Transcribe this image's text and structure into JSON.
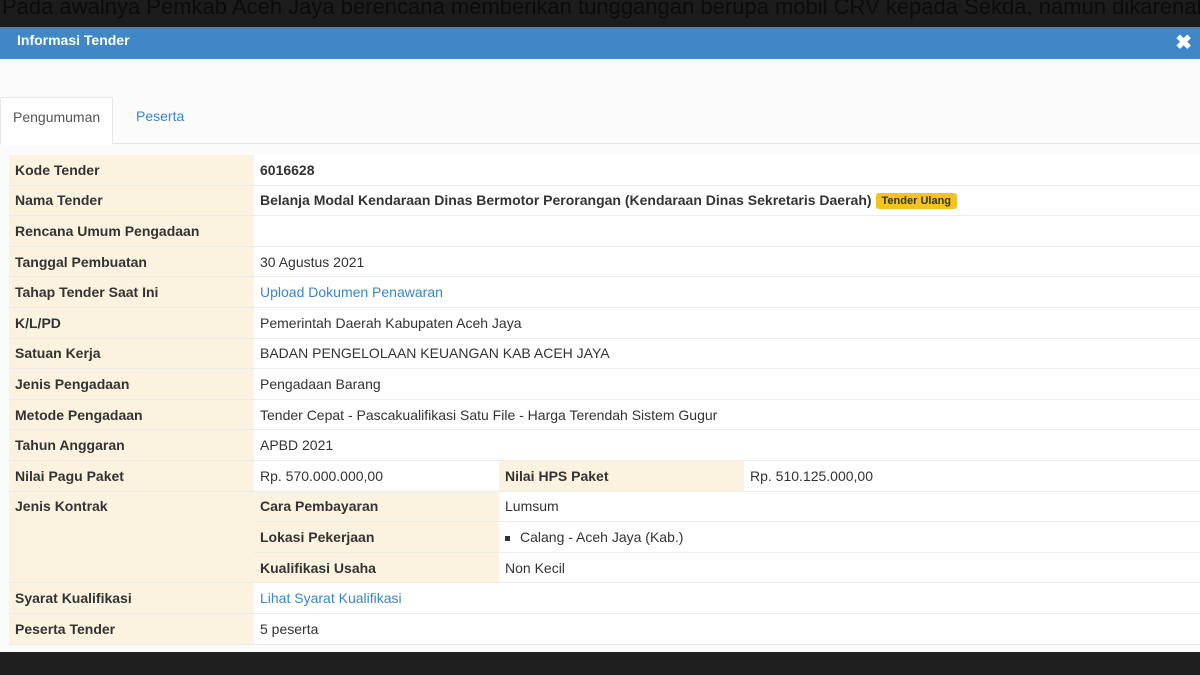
{
  "background_text": "Pada awalnya Pemkab Aceh Jaya berencana memberikan tunggangan berupa mobil CRV kepada Sekda, namun dikarenakan",
  "modal": {
    "title": "Informasi Tender",
    "close_icon": "close-icon"
  },
  "tabs": [
    {
      "label": "Pengumuman"
    },
    {
      "label": "Peserta"
    }
  ],
  "fields": {
    "kode_tender": {
      "label": "Kode Tender",
      "value": "6016628"
    },
    "nama_tender": {
      "label": "Nama Tender",
      "value": "Belanja Modal Kendaraan Dinas Bermotor Perorangan (Kendaraan Dinas Sekretaris Daerah)",
      "badge": "Tender Ulang"
    },
    "rup": {
      "label": "Rencana Umum Pengadaan",
      "value": ""
    },
    "tanggal": {
      "label": "Tanggal Pembuatan",
      "value": "30 Agustus 2021"
    },
    "tahap": {
      "label": "Tahap Tender Saat Ini",
      "value": "Upload Dokumen Penawaran"
    },
    "klpd": {
      "label": "K/L/PD",
      "value": "Pemerintah Daerah Kabupaten Aceh Jaya"
    },
    "satuan_kerja": {
      "label": "Satuan Kerja",
      "value": "BADAN PENGELOLAAN KEUANGAN KAB ACEH JAYA"
    },
    "jenis_pengadaan": {
      "label": "Jenis Pengadaan",
      "value": "Pengadaan Barang"
    },
    "metode": {
      "label": "Metode Pengadaan",
      "value": "Tender Cepat - Pascakualifikasi Satu File - Harga Terendah Sistem Gugur"
    },
    "tahun": {
      "label": "Tahun Anggaran",
      "value": "APBD 2021"
    },
    "pagu": {
      "label": "Nilai Pagu Paket",
      "value": "Rp. 570.000.000,00"
    },
    "hps": {
      "label": "Nilai HPS Paket",
      "value": "Rp. 510.125.000,00"
    },
    "jenis_kontrak": {
      "label": "Jenis Kontrak"
    },
    "cara_pembayaran": {
      "label": "Cara Pembayaran",
      "value": "Lumsum"
    },
    "lokasi": {
      "label": "Lokasi Pekerjaan",
      "value": "Calang - Aceh Jaya (Kab.)"
    },
    "kualifikasi_usaha": {
      "label": "Kualifikasi Usaha",
      "value": "Non Kecil"
    },
    "syarat": {
      "label": "Syarat Kualifikasi",
      "value": "Lihat Syarat Kualifikasi"
    },
    "peserta": {
      "label": "Peserta Tender",
      "value": "5 peserta"
    }
  },
  "colors": {
    "header": "#3f87c7",
    "label_bg": "#fbf3df",
    "link": "#3a86c6",
    "badge": "#f3c41b"
  }
}
